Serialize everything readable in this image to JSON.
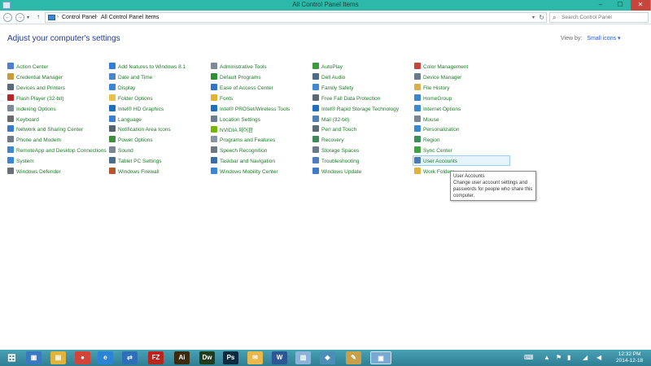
{
  "window": {
    "title": "All Control Panel Items",
    "controls": [
      "–",
      "☐",
      "✕"
    ]
  },
  "address": {
    "crumbs": [
      "Control Panel",
      "All Control Panel Items"
    ],
    "search_placeholder": "Search Control Panel"
  },
  "main": {
    "heading": "Adjust your computer's settings",
    "view_by_label": "View by:",
    "view_by_value": "Small icons ▾"
  },
  "columns": [
    {
      "items": [
        {
          "label": "Action Center",
          "icon": "flag-icon",
          "color": "#4c7fd0"
        },
        {
          "label": "Credential Manager",
          "icon": "vault-icon",
          "color": "#c99b3a"
        },
        {
          "label": "Devices and Printers",
          "icon": "printer-icon",
          "color": "#5b6a7a"
        },
        {
          "label": "Flash Player (32-bit)",
          "icon": "flash-icon",
          "color": "#b8252a"
        },
        {
          "label": "Indexing Options",
          "icon": "indexing-icon",
          "color": "#7d8a99"
        },
        {
          "label": "Keyboard",
          "icon": "keyboard-icon",
          "color": "#6b6b6b"
        },
        {
          "label": "Network and Sharing Center",
          "icon": "network-icon",
          "color": "#3a7bc8"
        },
        {
          "label": "Phone and Modem",
          "icon": "phone-icon",
          "color": "#6e7b88"
        },
        {
          "label": "RemoteApp and Desktop Connections",
          "icon": "remote-icon",
          "color": "#3f87c9"
        },
        {
          "label": "System",
          "icon": "system-icon",
          "color": "#3a86d6"
        },
        {
          "label": "Windows Defender",
          "icon": "defender-icon",
          "color": "#6a6f78"
        }
      ]
    },
    {
      "items": [
        {
          "label": "Add features to Windows 8.1",
          "icon": "windows-icon",
          "color": "#2f7fd6"
        },
        {
          "label": "Date and Time",
          "icon": "clock-icon",
          "color": "#4b86c9"
        },
        {
          "label": "Display",
          "icon": "display-icon",
          "color": "#3a86d6"
        },
        {
          "label": "Folder Options",
          "icon": "folder-icon",
          "color": "#e6c14b"
        },
        {
          "label": "Intel® HD Graphics",
          "icon": "intel-icon",
          "color": "#1e6fbf"
        },
        {
          "label": "Language",
          "icon": "language-icon",
          "color": "#3b7fcf"
        },
        {
          "label": "Notification Area Icons",
          "icon": "notification-icon",
          "color": "#566270"
        },
        {
          "label": "Power Options",
          "icon": "power-icon",
          "color": "#3e8e3e"
        },
        {
          "label": "Sound",
          "icon": "sound-icon",
          "color": "#7a8695"
        },
        {
          "label": "Tablet PC Settings",
          "icon": "tablet-icon",
          "color": "#4b6d8c"
        },
        {
          "label": "Windows Firewall",
          "icon": "firewall-icon",
          "color": "#b5562d"
        }
      ]
    },
    {
      "items": [
        {
          "label": "Administrative Tools",
          "icon": "admin-tools-icon",
          "color": "#7d8a99"
        },
        {
          "label": "Default Programs",
          "icon": "default-programs-icon",
          "color": "#2f8e3a"
        },
        {
          "label": "Ease of Access Center",
          "icon": "accessibility-icon",
          "color": "#2f74c9"
        },
        {
          "label": "Fonts",
          "icon": "fonts-icon",
          "color": "#e2b33a"
        },
        {
          "label": "Intel® PROSet/Wireless Tools",
          "icon": "wireless-icon",
          "color": "#1e6fbf"
        },
        {
          "label": "Location Settings",
          "icon": "location-icon",
          "color": "#6b7d8e"
        },
        {
          "label": "NVIDIA 제어판",
          "icon": "nvidia-icon",
          "color": "#76b900"
        },
        {
          "label": "Programs and Features",
          "icon": "programs-icon",
          "color": "#8a95a3"
        },
        {
          "label": "Speech Recognition",
          "icon": "microphone-icon",
          "color": "#6c7884"
        },
        {
          "label": "Taskbar and Navigation",
          "icon": "taskbar-icon",
          "color": "#3a6ea8"
        },
        {
          "label": "Windows Mobility Center",
          "icon": "mobility-icon",
          "color": "#3a86d6"
        }
      ]
    },
    {
      "items": [
        {
          "label": "AutoPlay",
          "icon": "autoplay-icon",
          "color": "#3f9a3f"
        },
        {
          "label": "Dell Audio",
          "icon": "audio-icon",
          "color": "#4d6a88"
        },
        {
          "label": "Family Safety",
          "icon": "family-icon",
          "color": "#3e8bd1"
        },
        {
          "label": "Free Fall Data Protection",
          "icon": "freefall-icon",
          "color": "#5a6878"
        },
        {
          "label": "Intel® Rapid Storage Technology",
          "icon": "storage-tech-icon",
          "color": "#1e6fbf"
        },
        {
          "label": "Mail (32-bit)",
          "icon": "mail-icon",
          "color": "#4e7fb5"
        },
        {
          "label": "Pen and Touch",
          "icon": "pen-icon",
          "color": "#5c6a78"
        },
        {
          "label": "Recovery",
          "icon": "recovery-icon",
          "color": "#3d8a5a"
        },
        {
          "label": "Storage Spaces",
          "icon": "storage-icon",
          "color": "#6a7a8a"
        },
        {
          "label": "Troubleshooting",
          "icon": "troubleshoot-icon",
          "color": "#4d7fc0"
        },
        {
          "label": "Windows Update",
          "icon": "update-icon",
          "color": "#3e7bc7"
        }
      ]
    },
    {
      "items": [
        {
          "label": "Color Management",
          "icon": "color-icon",
          "color": "#c9453b"
        },
        {
          "label": "Device Manager",
          "icon": "device-manager-icon",
          "color": "#6a7a8a"
        },
        {
          "label": "File History",
          "icon": "file-history-icon",
          "color": "#d9b24a"
        },
        {
          "label": "HomeGroup",
          "icon": "homegroup-icon",
          "color": "#3c86cf"
        },
        {
          "label": "Internet Options",
          "icon": "internet-icon",
          "color": "#3b8ad4"
        },
        {
          "label": "Mouse",
          "icon": "mouse-icon",
          "color": "#7a8692"
        },
        {
          "label": "Personalization",
          "icon": "personalization-icon",
          "color": "#3a86d6"
        },
        {
          "label": "Region",
          "icon": "region-icon",
          "color": "#3b8f5a"
        },
        {
          "label": "Sync Center",
          "icon": "sync-icon",
          "color": "#3fa33f"
        },
        {
          "label": "User Accounts",
          "icon": "user-icon",
          "color": "#4b79b8"
        },
        {
          "label": "Work Folders",
          "icon": "work-folders-icon",
          "color": "#e2b33a"
        }
      ]
    }
  ],
  "tooltip": {
    "title": "User Accounts",
    "text": "Change user account settings and passwords for people who share this computer."
  },
  "taskbar": {
    "apps": [
      {
        "name": "start-button-icon",
        "glyph": "⊞",
        "color": "#2e7fb0"
      },
      {
        "name": "control-panel-pinned-icon",
        "glyph": "▣",
        "color": "#3a78c4"
      },
      {
        "name": "file-explorer-icon",
        "glyph": "▤",
        "color": "#e2b33a"
      },
      {
        "name": "chrome-icon",
        "glyph": "●",
        "color": "#d34436"
      },
      {
        "name": "internet-explorer-icon",
        "glyph": "e",
        "color": "#2b84d6"
      },
      {
        "name": "teamviewer-icon",
        "glyph": "⇄",
        "color": "#2e6fb8"
      },
      {
        "name": "filezilla-icon",
        "glyph": "FZ",
        "color": "#b6261e"
      },
      {
        "name": "illustrator-icon",
        "glyph": "Ai",
        "color": "#3a2a0e"
      },
      {
        "name": "dreamweaver-icon",
        "glyph": "Dw",
        "color": "#1f3d1a"
      },
      {
        "name": "photoshop-icon",
        "glyph": "Ps",
        "color": "#0c2a40"
      },
      {
        "name": "folder-app-icon",
        "glyph": "✉",
        "color": "#e8b84a"
      },
      {
        "name": "word-icon",
        "glyph": "W",
        "color": "#2b5797"
      },
      {
        "name": "notepad-icon",
        "glyph": "▥",
        "color": "#8db2d9"
      },
      {
        "name": "app-icon",
        "glyph": "◆",
        "color": "#4a8fb8"
      },
      {
        "name": "sticky-tool-icon",
        "glyph": "✎",
        "color": "#c9a04a"
      },
      {
        "name": "control-panel-active-icon",
        "glyph": "▣",
        "color": "#78a9d1"
      }
    ],
    "tray_icons": [
      "⌨",
      "▲",
      "⚑",
      "▮",
      "◢",
      "◀"
    ],
    "time": "12:32 PM",
    "date": "2014-12-18"
  }
}
